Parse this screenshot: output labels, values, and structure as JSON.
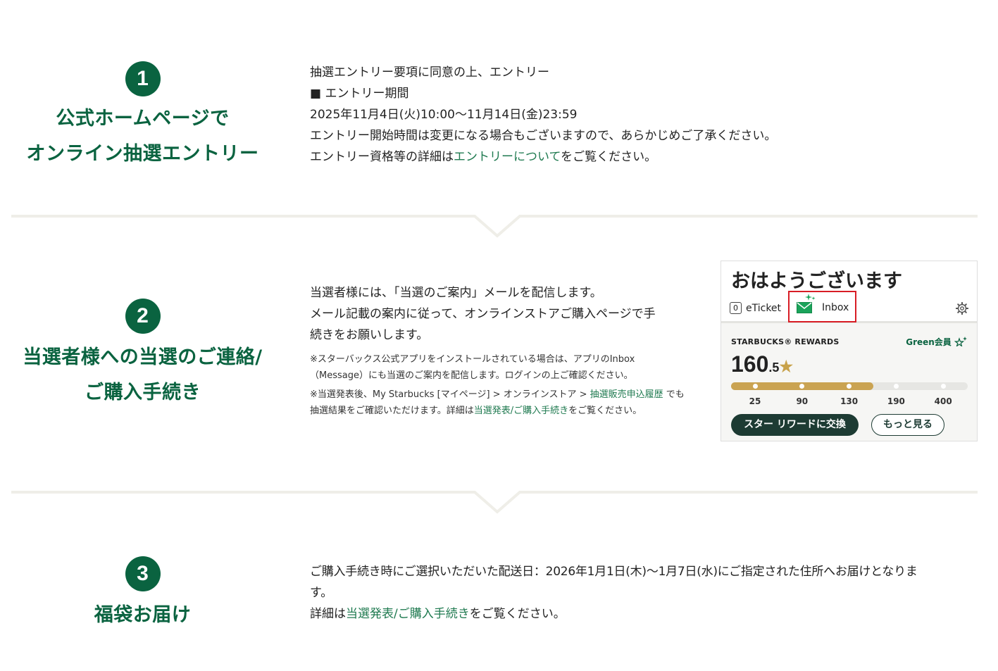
{
  "steps": [
    {
      "number": "1",
      "title_lines": [
        "公式ホームページで",
        "オンライン抽選エントリー"
      ],
      "lines": [
        "抽選エントリー要項に同意の上、エントリー",
        "■ エントリー期間",
        "2025年11月4日(火)10:00〜11月14日(金)23:59",
        "エントリー開始時間は変更になる場合もございますので、あらかじめご了承ください。"
      ],
      "detail_prefix": "エントリー資格等の詳細は",
      "detail_link": "エントリーについて",
      "detail_suffix": "をご覧ください。"
    },
    {
      "number": "2",
      "title_lines": [
        "当選者様への当選のご連絡/",
        "ご購入手続き"
      ],
      "lines": [
        "当選者様には、「当選のご案内」メールを配信します。",
        "メール記載の案内に従って、オンラインストアご購入ページで手",
        "続きをお願いします。"
      ],
      "note1_line1": "※スターバックス公式アプリをインストールされている場合は、アプリのInbox",
      "note1_line2": "（Message）にも当選のご案内を配信します。ログインの上ご確認ください。",
      "note2_prefix": "※当選発表後、My Starbucks [マイページ] > オンラインストア > ",
      "note2_link": "抽選販売申込履歴",
      "note2_suffix": " でも",
      "note3_prefix": "抽選結果をご確認いただけます。詳細は",
      "note3_link": "当選発表/ご購入手続き",
      "note3_suffix": "をご覧ください。"
    },
    {
      "number": "3",
      "title_lines": [
        "福袋お届け"
      ],
      "line1": "ご購入手続き時にご選択いただいた配送日：2026年1月1日(木)〜1月7日(水)にご指定された住所へお届けとなりま",
      "line2": "す。",
      "detail_prefix": "詳細は",
      "detail_link": "当選発表/ご購入手続き",
      "detail_suffix": "をご覧ください。"
    }
  ],
  "app_card": {
    "greeting": "おはようございます",
    "eticket_count": "0",
    "eticket_label": "eTicket",
    "inbox_label": "Inbox",
    "rewards_label": "STARBUCKS® REWARDS",
    "member_label": "Green会員",
    "stars_int": "160",
    "stars_dec": ".5",
    "star_glyph": "★",
    "progress_value": 160.5,
    "ticks": [
      "25",
      "90",
      "130",
      "190",
      "400"
    ],
    "primary_button": "スター リワードに交換",
    "secondary_button": "もっと見る"
  },
  "colors": {
    "brand_green": "#0a6340",
    "link_green": "#1f7a50",
    "gold": "#caa352",
    "highlight_red": "#d81d25",
    "dark_button": "#1d3b33"
  }
}
